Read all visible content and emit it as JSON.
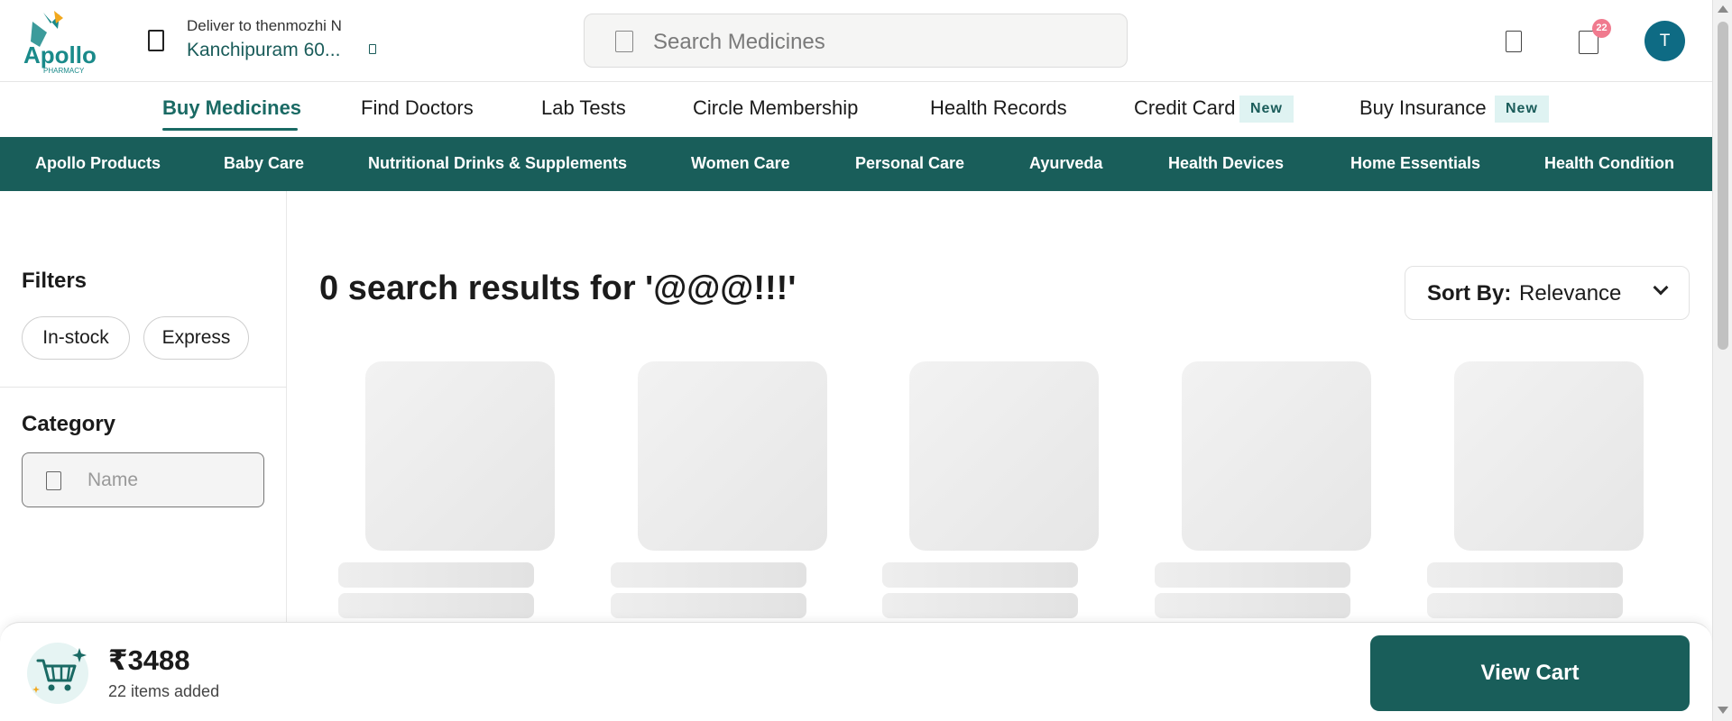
{
  "logo": {
    "name": "Apollo",
    "sub": "PHARMACY",
    "brand_color": "#1a8a8a",
    "accent_color": "#f2a81d"
  },
  "delivery": {
    "label": "Deliver to thenmozhi N",
    "location": "Kanchipuram 60...",
    "icon": "location-icon"
  },
  "search": {
    "placeholder": "Search Medicines",
    "icon": "search-icon"
  },
  "header_icons": {
    "notification_icon": "bell-icon",
    "cart_icon": "cart-icon",
    "cart_count": "22",
    "avatar_initial": "T",
    "avatar_color": "#0e6b84"
  },
  "primary_nav": [
    {
      "label": "Buy Medicines",
      "active": true
    },
    {
      "label": "Find Doctors"
    },
    {
      "label": "Lab Tests"
    },
    {
      "label": "Circle Membership"
    },
    {
      "label": "Health Records"
    },
    {
      "label": "Credit Card",
      "badge": "New"
    },
    {
      "label": "Buy Insurance",
      "badge": "New"
    }
  ],
  "category_nav": [
    "Apollo Products",
    "Baby Care",
    "Nutritional Drinks & Supplements",
    "Women Care",
    "Personal Care",
    "Ayurveda",
    "Health Devices",
    "Home Essentials",
    "Health Condition"
  ],
  "filters": {
    "title": "Filters",
    "chips": [
      "In-stock",
      "Express"
    ],
    "category_title": "Category",
    "category_placeholder": "Name"
  },
  "results": {
    "title": "0 search results for '@@@!!!'",
    "sort_label": "Sort By:",
    "sort_value": "Relevance"
  },
  "cart_bar": {
    "total": "₹3488",
    "items": "22 items added",
    "button": "View Cart",
    "icon": "cart-sparkle-icon"
  },
  "colors": {
    "primary_dark": "#195e5a",
    "active_text": "#1a6a64",
    "badge_bg": "#dff3f2",
    "cart_badge": "#f07a8e"
  }
}
